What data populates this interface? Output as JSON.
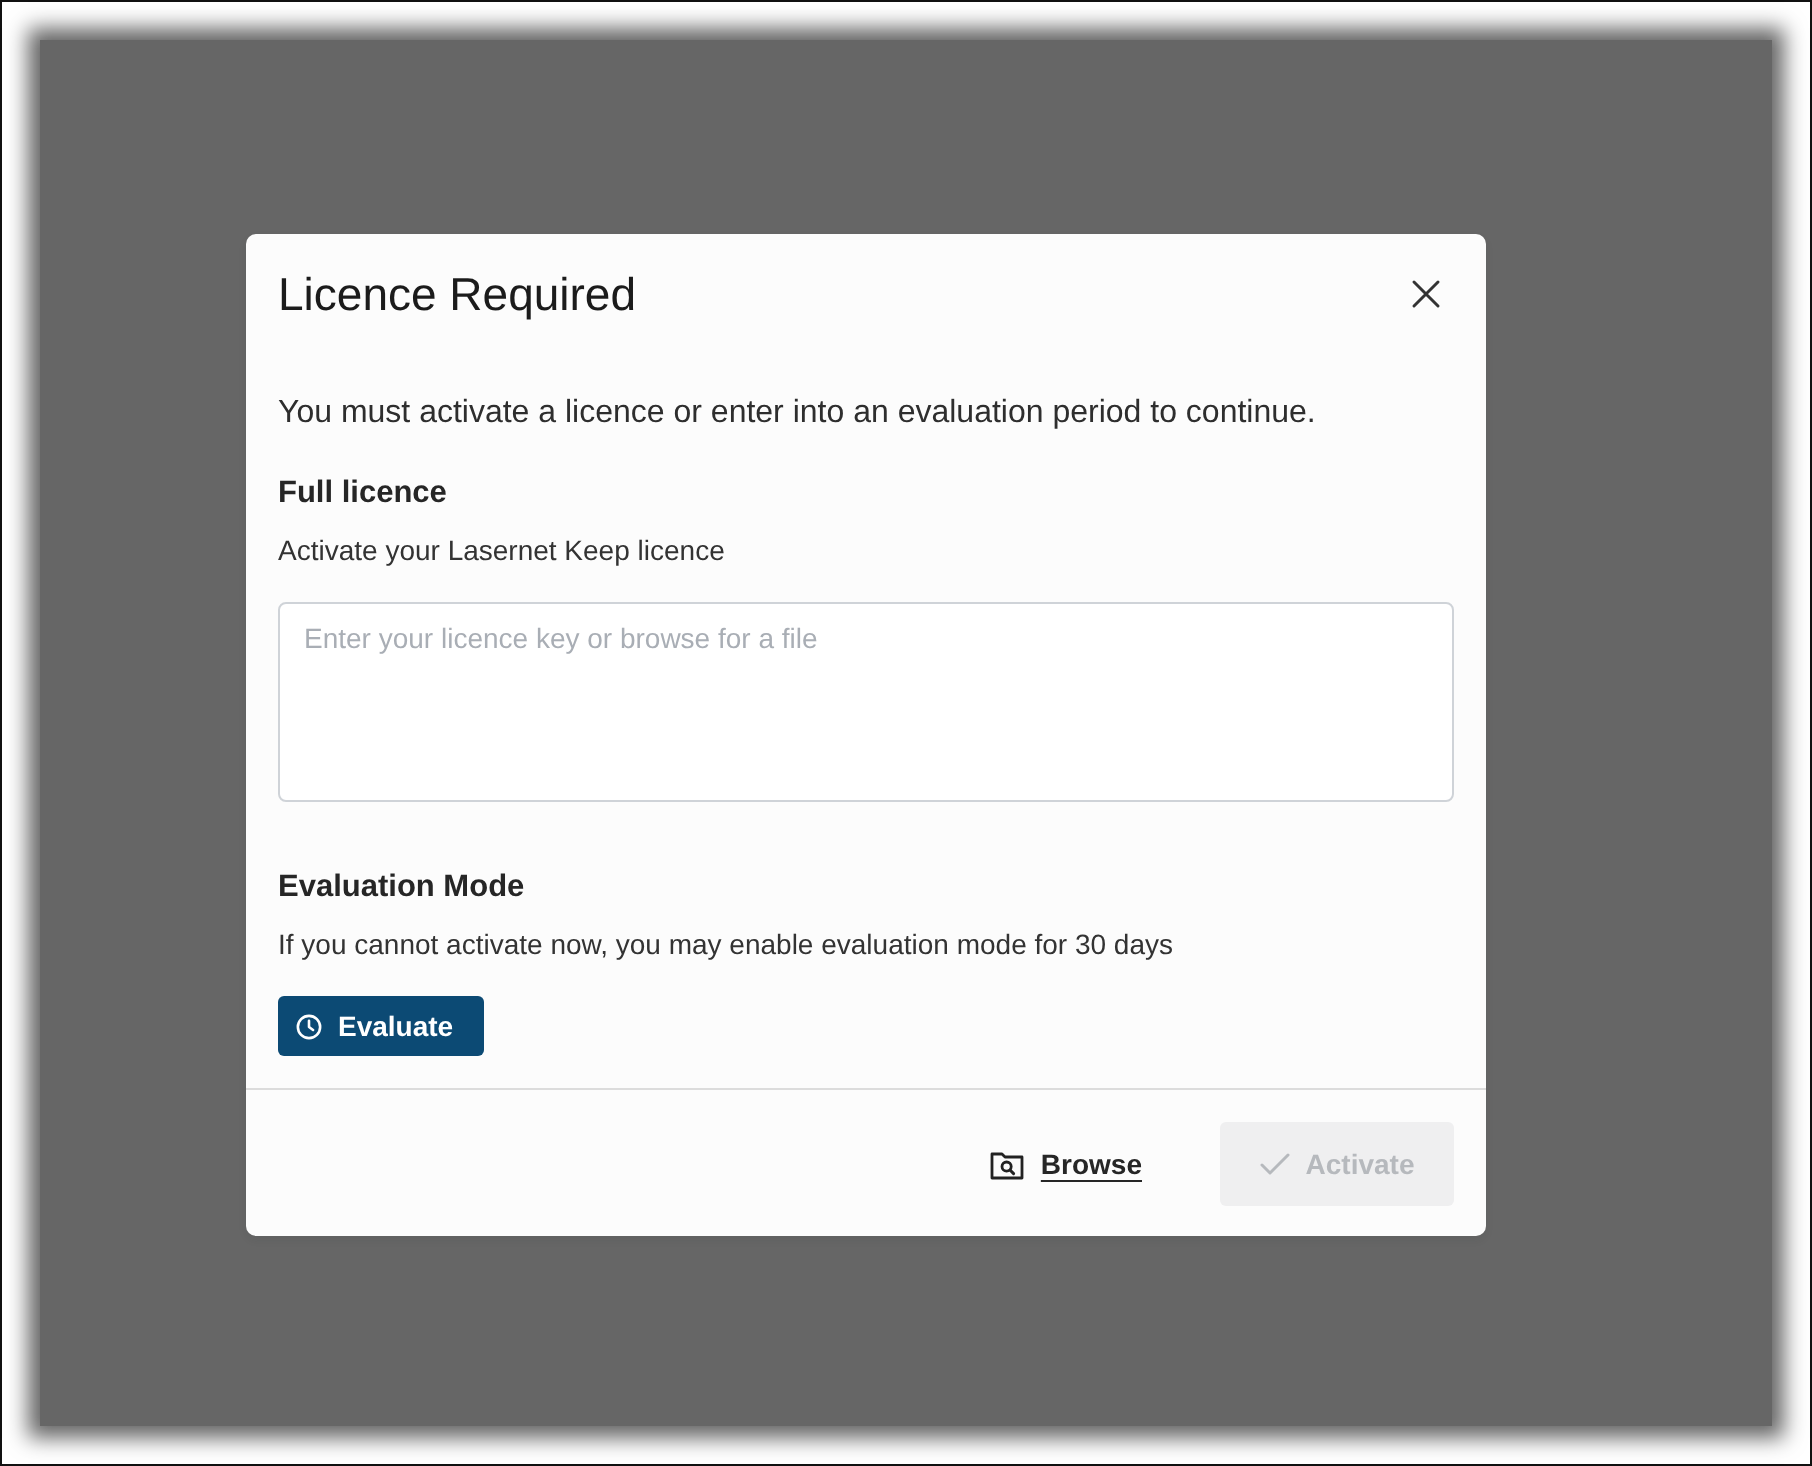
{
  "dialog": {
    "title": "Licence Required",
    "message": "You must activate a licence or enter into an evaluation period to continue."
  },
  "full_licence": {
    "heading": "Full licence",
    "description": "Activate your Lasernet Keep licence",
    "field": {
      "placeholder": "Enter your licence key or browse for a file"
    }
  },
  "evaluation": {
    "heading": "Evaluation Mode",
    "description": "If you cannot activate now, you may enable evaluation mode for 30 days",
    "button": {
      "label": "Evaluate"
    }
  },
  "footer": {
    "browse_link": {
      "label": "Browse"
    },
    "activate_button": {
      "label": "Activate",
      "disabled": true
    }
  }
}
